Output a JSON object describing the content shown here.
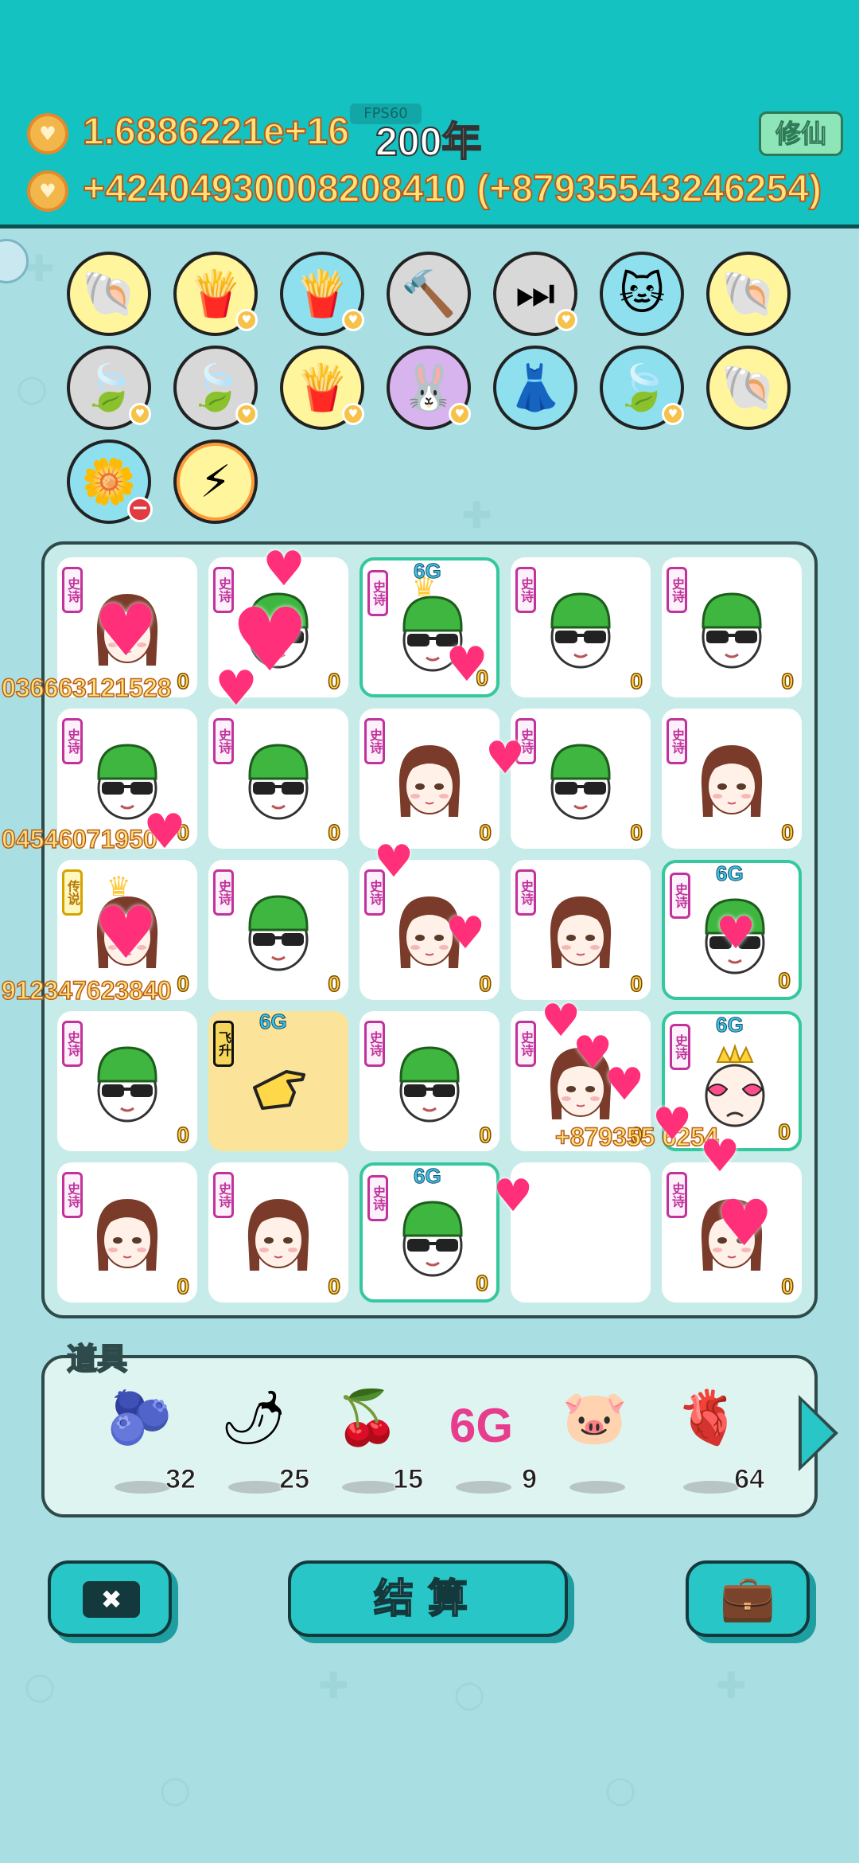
{
  "header": {
    "coins_total": "1.6886221e+16",
    "year": "200年",
    "coins_rate": "+424049300082084",
    "coins_rate_tail": "10 (+87935543246254)",
    "fps": "FPS60",
    "cultivate_button": "修仙"
  },
  "upgrades": [
    {
      "icon": "shell-icon",
      "bg": "#fff59c",
      "badge": false
    },
    {
      "icon": "fries-icon",
      "bg": "#fff59c",
      "badge": true
    },
    {
      "icon": "fries-icon",
      "bg": "#8ee0ee",
      "badge": true
    },
    {
      "icon": "hammer-icon",
      "bg": "#d8d8d8",
      "badge": false
    },
    {
      "icon": "skip-icon",
      "bg": "#d8d8d8",
      "badge": true
    },
    {
      "icon": "cat-icon",
      "bg": "#8ee0ee",
      "badge": false
    },
    {
      "icon": "shell-icon",
      "bg": "#fff59c",
      "badge": false
    },
    {
      "icon": "leaf-icon",
      "bg": "#d8d8d8",
      "badge": true
    },
    {
      "icon": "leaf-icon",
      "bg": "#d8d8d8",
      "badge": true
    },
    {
      "icon": "fries-icon",
      "bg": "#fff59c",
      "badge": true
    },
    {
      "icon": "rabbit-icon",
      "bg": "#d7b4ee",
      "badge": true
    },
    {
      "icon": "skirt-icon",
      "bg": "#8ee0ee",
      "badge": false
    },
    {
      "icon": "leaf-icon",
      "bg": "#8ee0ee",
      "badge": true
    },
    {
      "icon": "shell-icon",
      "bg": "#fff59c",
      "badge": false
    },
    {
      "icon": "flower-pot-icon",
      "bg": "#8ee0ee",
      "minus": true
    },
    {
      "icon": "lightning-icon",
      "bg": "#fff59c",
      "badge": false
    }
  ],
  "upgrade_glyphs": {
    "shell-icon": "🐚",
    "fries-icon": "🍟",
    "hammer-icon": "🔨",
    "skip-icon": "⏭",
    "cat-icon": "🐱",
    "leaf-icon": "🍃",
    "rabbit-icon": "🐰",
    "skirt-icon": "👗",
    "flower-pot-icon": "🌼",
    "lightning-icon": "⚡"
  },
  "board": {
    "cells": [
      {
        "type": "girl",
        "tag": "史诗",
        "level": "0",
        "crown": false
      },
      {
        "type": "guy",
        "tag": "史诗",
        "level": "0",
        "crown": false
      },
      {
        "type": "guy",
        "tag": "史诗",
        "level": "0",
        "crown": true,
        "hl": true,
        "sixg": "6G"
      },
      {
        "type": "guy",
        "tag": "史诗",
        "level": "0",
        "crown": false
      },
      {
        "type": "guy",
        "tag": "史诗",
        "level": "0",
        "crown": false
      },
      {
        "type": "guy",
        "tag": "史诗",
        "level": "0",
        "crown": false
      },
      {
        "type": "guy",
        "tag": "史诗",
        "level": "0",
        "crown": false
      },
      {
        "type": "girl",
        "tag": "史诗",
        "level": "0",
        "crown": false
      },
      {
        "type": "guy",
        "tag": "史诗",
        "level": "0",
        "crown": false
      },
      {
        "type": "girl",
        "tag": "史诗",
        "level": "0",
        "crown": false
      },
      {
        "type": "girl",
        "tag": "传说",
        "level": "0",
        "crown": true,
        "legend": true
      },
      {
        "type": "guy",
        "tag": "史诗",
        "level": "0",
        "crown": false
      },
      {
        "type": "girl",
        "tag": "史诗",
        "level": "0",
        "crown": false
      },
      {
        "type": "girl",
        "tag": "史诗",
        "level": "0",
        "crown": false
      },
      {
        "type": "guy",
        "tag": "史诗",
        "level": "0",
        "crown": false,
        "hl": true,
        "sixg": "6G"
      },
      {
        "type": "guy",
        "tag": "史诗",
        "level": "0",
        "crown": false
      },
      {
        "type": "hand",
        "tag": "飞升",
        "level": "",
        "crown": false,
        "gold": true,
        "sixg": "6G"
      },
      {
        "type": "guy",
        "tag": "史诗",
        "level": "0",
        "crown": false
      },
      {
        "type": "girl",
        "tag": "史诗",
        "level": "0",
        "crown": false
      },
      {
        "type": "king",
        "tag": "史诗",
        "level": "0",
        "crown": true,
        "hl": true,
        "sixg": "6G"
      },
      {
        "type": "girl",
        "tag": "史诗",
        "level": "0",
        "crown": false
      },
      {
        "type": "girl",
        "tag": "史诗",
        "level": "0",
        "crown": false
      },
      {
        "type": "guy",
        "tag": "史诗",
        "level": "0",
        "crown": false,
        "hl": true,
        "sixg": "6G"
      },
      {
        "type": "empty",
        "tag": "",
        "level": "",
        "crown": false
      },
      {
        "type": "girl",
        "tag": "史诗",
        "level": "0",
        "crown": false
      }
    ],
    "earnings": [
      {
        "text": "036663121528"
      },
      {
        "text": "04546071950"
      },
      {
        "text": "912347623840"
      },
      {
        "text": "+879355",
        "text2": "6254"
      }
    ]
  },
  "items": {
    "title": "道具",
    "list": [
      {
        "icon": "blueberry-icon",
        "glyph": "🫐",
        "count": "32"
      },
      {
        "icon": "chili-icon",
        "glyph": "🌶",
        "count": "25"
      },
      {
        "icon": "bayberry-icon",
        "glyph": "🍒",
        "count": "15"
      },
      {
        "icon": "6g-icon",
        "glyph": "6G",
        "count": "9"
      },
      {
        "icon": "piggy-bank-icon",
        "glyph": "🐷",
        "count": ""
      },
      {
        "icon": "liver-icon",
        "glyph": "🫀",
        "count": "64"
      }
    ]
  },
  "buttons": {
    "close_glyph": "✖",
    "settle": "结算",
    "bag_glyph": "💼"
  },
  "colors": {
    "header": "#13c2c1",
    "accent": "#28c6c6",
    "coin_text": "#ffe27a",
    "level_text": "#ffd34a"
  }
}
